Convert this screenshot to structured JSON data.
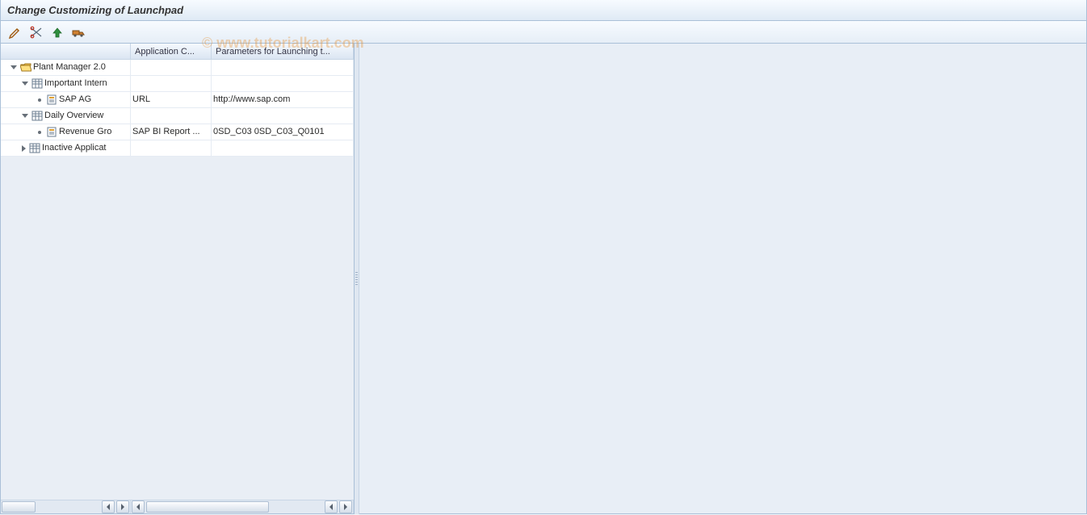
{
  "title": "Change Customizing of Launchpad",
  "watermark": "© www.tutorialkart.com",
  "toolbar": {
    "btn1": "edit-icon",
    "btn2": "cut-icon",
    "btn3": "up-icon",
    "btn4": "transport-icon"
  },
  "tree": {
    "headers": {
      "tree": "",
      "app_category": "Application C...",
      "parameters": "Parameters for Launching t..."
    },
    "root": {
      "label": "Plant Manager 2.0",
      "expanded": true,
      "children": [
        {
          "label": "Important Intern",
          "expanded": true,
          "children": [
            {
              "label": "SAP AG",
              "app_category": "URL",
              "parameters": "http://www.sap.com"
            }
          ]
        },
        {
          "label": "Daily Overview",
          "expanded": true,
          "children": [
            {
              "label": "Revenue Gro",
              "app_category": "SAP BI Report ...",
              "parameters": "0SD_C03 0SD_C03_Q0101"
            }
          ]
        },
        {
          "label": "Inactive Applicat",
          "expanded": false
        }
      ]
    }
  }
}
